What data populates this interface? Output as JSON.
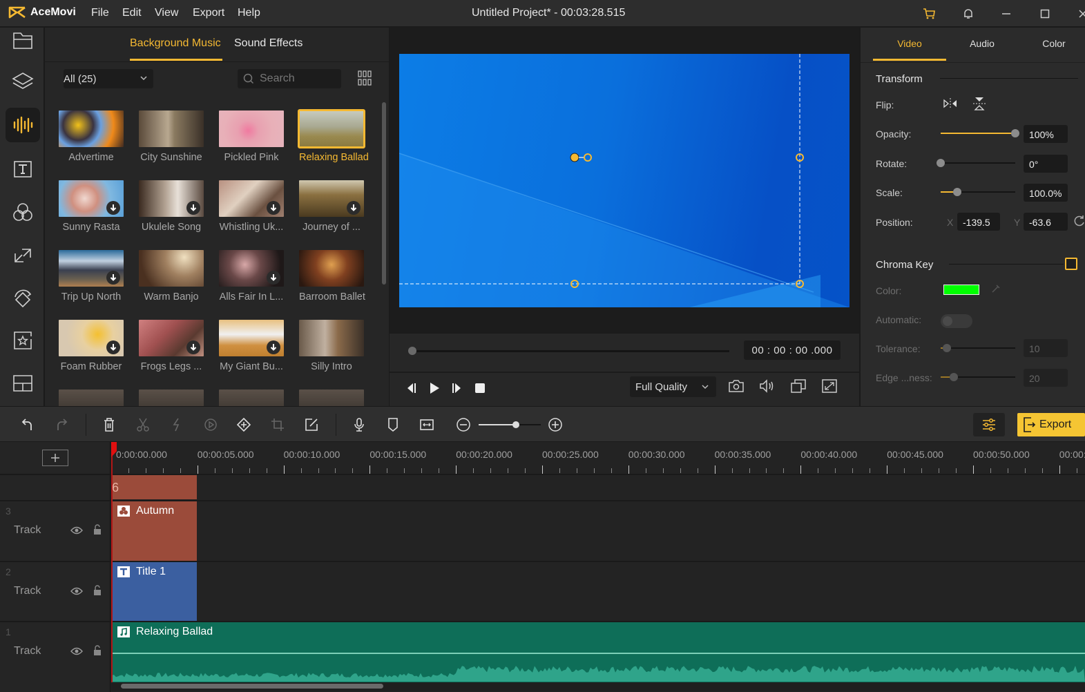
{
  "app": {
    "name": "AceMovi",
    "window_title": "Untitled Project* - 00:03:28.515",
    "menu": [
      "File",
      "Edit",
      "View",
      "Export",
      "Help"
    ],
    "window_icons": [
      "cart-icon",
      "bell-icon",
      "minimize-icon",
      "maximize-icon",
      "close-icon"
    ]
  },
  "sidebar": {
    "items": [
      {
        "name": "media",
        "icon": "folder-icon"
      },
      {
        "name": "layers",
        "icon": "layers-icon"
      },
      {
        "name": "audio",
        "icon": "audio-wave-icon",
        "active": true
      },
      {
        "name": "text",
        "icon": "text-icon"
      },
      {
        "name": "filters",
        "icon": "filters-icon"
      },
      {
        "name": "transitions",
        "icon": "transition-icon"
      },
      {
        "name": "animations",
        "icon": "animation-icon"
      },
      {
        "name": "elements",
        "icon": "star-icon"
      },
      {
        "name": "split-screen",
        "icon": "layout-icon"
      }
    ]
  },
  "library": {
    "tabs": [
      {
        "label": "Background Music",
        "active": true
      },
      {
        "label": "Sound Effects",
        "active": false
      }
    ],
    "filter": "All (25)",
    "search_placeholder": "Search",
    "items": [
      {
        "label": "Advertime",
        "download": false,
        "selected": false
      },
      {
        "label": "City Sunshine",
        "download": false,
        "selected": false
      },
      {
        "label": "Pickled Pink",
        "download": false,
        "selected": false
      },
      {
        "label": "Relaxing Ballad",
        "download": false,
        "selected": true
      },
      {
        "label": "Sunny Rasta",
        "download": true,
        "selected": false
      },
      {
        "label": "Ukulele Song",
        "download": true,
        "selected": false
      },
      {
        "label": "Whistling Uk...",
        "download": true,
        "selected": false
      },
      {
        "label": "Journey of ...",
        "download": true,
        "selected": false
      },
      {
        "label": "Trip Up North",
        "download": true,
        "selected": false
      },
      {
        "label": "Warm Banjo",
        "download": false,
        "selected": false
      },
      {
        "label": "Alls Fair In L...",
        "download": true,
        "selected": false
      },
      {
        "label": "Barroom Ballet",
        "download": false,
        "selected": false
      },
      {
        "label": "Foam Rubber",
        "download": true,
        "selected": false
      },
      {
        "label": "Frogs Legs ...",
        "download": true,
        "selected": false
      },
      {
        "label": "My Giant Bu...",
        "download": true,
        "selected": false
      },
      {
        "label": "Silly Intro",
        "download": false,
        "selected": false
      }
    ]
  },
  "preview": {
    "timecode": "00 : 00 : 00 .000",
    "seek_progress": 0,
    "quality": "Full Quality"
  },
  "properties": {
    "tabs": [
      {
        "label": "Video",
        "active": true
      },
      {
        "label": "Audio",
        "active": false
      },
      {
        "label": "Color",
        "active": false
      }
    ],
    "transform": {
      "title": "Transform",
      "flip_label": "Flip:",
      "opacity_label": "Opacity:",
      "opacity_value": "100%",
      "opacity_level": 1.0,
      "rotate_label": "Rotate:",
      "rotate_value": "0°",
      "rotate_level": 0.0,
      "scale_label": "Scale:",
      "scale_value": "100.0%",
      "scale_level": 0.22,
      "position_label": "Position:",
      "x_label": "X",
      "x_value": "-139.5",
      "y_label": "Y",
      "y_value": "-63.6"
    },
    "chroma": {
      "title": "Chroma Key",
      "enabled": false,
      "color_label": "Color:",
      "color": "#00ff00",
      "automatic_label": "Automatic:",
      "tolerance_label": "Tolerance:",
      "tolerance_value": "10",
      "tolerance_level": 0.08,
      "edge_label": "Edge ...ness:",
      "edge_value": "20",
      "edge_level": 0.18
    }
  },
  "toolbar": {
    "tools": [
      "undo",
      "redo",
      "delete",
      "cut",
      "split",
      "speed",
      "add-marker",
      "crop",
      "edit",
      "record",
      "marker",
      "fit",
      "zoom-out",
      "zoom-in"
    ],
    "zoom_level": 0.6,
    "export_label": "Export"
  },
  "timeline": {
    "ruler": [
      "0:00:00.000",
      "00:00:05.000",
      "00:00:10.000",
      "00:00:15.000",
      "00:00:20.000",
      "00:00:25.000",
      "00:00:30.000",
      "00:00:35.000",
      "00:00:40.000",
      "00:00:45.000",
      "00:00:50.000",
      "00:00:"
    ],
    "tracks": [
      {
        "number": "3",
        "label": "Track",
        "clip": "Autumn",
        "clip_icon": "filter-icon",
        "color": "#9b4b3a"
      },
      {
        "number": "2",
        "label": "Track",
        "clip": "Title 1",
        "clip_icon": "text-icon",
        "color": "#3b5fa0"
      },
      {
        "number": "1",
        "label": "Track",
        "clip": "Relaxing Ballad",
        "clip_icon": "music-icon",
        "color": "#0e6e58"
      }
    ]
  },
  "colors": {
    "accent": "#f5b932",
    "export": "#f5c533",
    "playhead": "#b01515"
  }
}
